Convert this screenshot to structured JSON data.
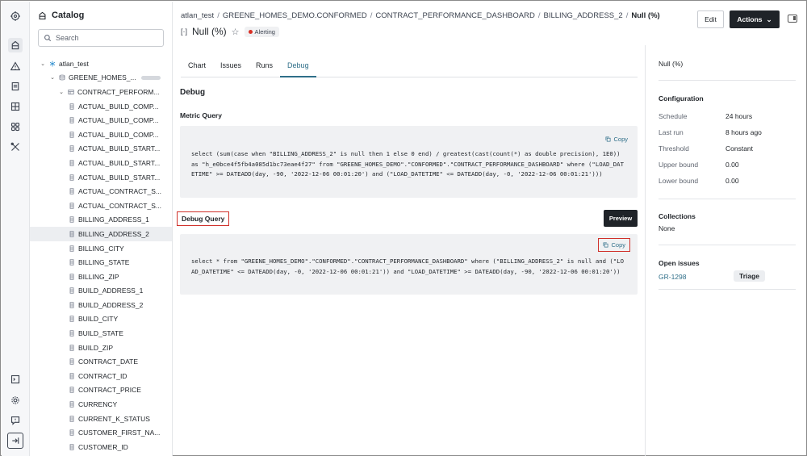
{
  "catalog": {
    "title": "Catalog",
    "search_placeholder": "Search",
    "tree": [
      {
        "label": "atlan_test",
        "level": 0,
        "chev": "⌄",
        "icon": "snowflake-icon"
      },
      {
        "label": "GREENE_HOMES_...",
        "level": 1,
        "chev": "⌄",
        "icon": "database-icon",
        "pill": true
      },
      {
        "label": "CONTRACT_PERFORM...",
        "level": 2,
        "chev": "⌄",
        "icon": "table-icon"
      },
      {
        "label": "ACTUAL_BUILD_COMP...",
        "level": 3,
        "icon": "column-icon"
      },
      {
        "label": "ACTUAL_BUILD_COMP...",
        "level": 3,
        "icon": "column-icon"
      },
      {
        "label": "ACTUAL_BUILD_COMP...",
        "level": 3,
        "icon": "column-icon"
      },
      {
        "label": "ACTUAL_BUILD_START...",
        "level": 3,
        "icon": "column-icon"
      },
      {
        "label": "ACTUAL_BUILD_START...",
        "level": 3,
        "icon": "column-icon"
      },
      {
        "label": "ACTUAL_BUILD_START...",
        "level": 3,
        "icon": "column-icon"
      },
      {
        "label": "ACTUAL_CONTRACT_S...",
        "level": 3,
        "icon": "column-icon"
      },
      {
        "label": "ACTUAL_CONTRACT_S...",
        "level": 3,
        "icon": "column-icon"
      },
      {
        "label": "BILLING_ADDRESS_1",
        "level": 3,
        "icon": "column-icon"
      },
      {
        "label": "BILLING_ADDRESS_2",
        "level": 3,
        "icon": "column-icon",
        "selected": true
      },
      {
        "label": "BILLING_CITY",
        "level": 3,
        "icon": "column-icon"
      },
      {
        "label": "BILLING_STATE",
        "level": 3,
        "icon": "column-icon"
      },
      {
        "label": "BILLING_ZIP",
        "level": 3,
        "icon": "column-icon"
      },
      {
        "label": "BUILD_ADDRESS_1",
        "level": 3,
        "icon": "column-icon"
      },
      {
        "label": "BUILD_ADDRESS_2",
        "level": 3,
        "icon": "column-icon"
      },
      {
        "label": "BUILD_CITY",
        "level": 3,
        "icon": "column-icon"
      },
      {
        "label": "BUILD_STATE",
        "level": 3,
        "icon": "column-icon"
      },
      {
        "label": "BUILD_ZIP",
        "level": 3,
        "icon": "column-icon"
      },
      {
        "label": "CONTRACT_DATE",
        "level": 3,
        "icon": "column-icon"
      },
      {
        "label": "CONTRACT_ID",
        "level": 3,
        "icon": "column-icon"
      },
      {
        "label": "CONTRACT_PRICE",
        "level": 3,
        "icon": "column-icon"
      },
      {
        "label": "CURRENCY",
        "level": 3,
        "icon": "column-icon"
      },
      {
        "label": "CURRENT_K_STATUS",
        "level": 3,
        "icon": "column-icon"
      },
      {
        "label": "CUSTOMER_FIRST_NA...",
        "level": 3,
        "icon": "column-icon"
      },
      {
        "label": "CUSTOMER_ID",
        "level": 3,
        "icon": "column-icon"
      }
    ]
  },
  "breadcrumb": {
    "items": [
      "atlan_test",
      "GREENE_HOMES_DEMO.CONFORMED",
      "CONTRACT_PERFORMANCE_DASHBOARD",
      "BILLING_ADDRESS_2"
    ],
    "current": "Null (%)",
    "separator": "/"
  },
  "header": {
    "bracket": "[·]",
    "title": "Null (%)",
    "star": "☆",
    "badge": "Alerting",
    "edit_label": "Edit",
    "actions_label": "Actions",
    "actions_chevron": "⌄"
  },
  "tabs": [
    {
      "label": "Chart",
      "active": false
    },
    {
      "label": "Issues",
      "active": false
    },
    {
      "label": "Runs",
      "active": false
    },
    {
      "label": "Debug",
      "active": true
    }
  ],
  "debug": {
    "heading": "Debug",
    "metric_heading": "Metric Query",
    "copy_label": "Copy",
    "metric_query": "select (sum(case when \"BILLING_ADDRESS_2\" is null then 1 else 0 end) / greatest(cast(count(*) as double precision), 1E0)) as \"h_e0bce4f5fb4a085d1bc73eae4f27\" from \"GREENE_HOMES_DEMO\".\"CONFORMED\".\"CONTRACT_PERFORMANCE_DASHBOARD\" where (\"LOAD_DATETIME\" >= DATEADD(day, -90, '2022-12-06 00:01:20') and (\"LOAD_DATETIME\" <= DATEADD(day, -0, '2022-12-06 00:01:21')))",
    "debug_heading": "Debug Query",
    "preview_label": "Preview",
    "debug_query": "select * from \"GREENE_HOMES_DEMO\".\"CONFORMED\".\"CONTRACT_PERFORMANCE_DASHBOARD\" where (\"BILLING_ADDRESS_2\" is null and (\"LOAD_DATETIME\" <= DATEADD(day, -0, '2022-12-06 00:01:21')) and \"LOAD_DATETIME\" >= DATEADD(day, -90, '2022-12-06 00:01:20'))"
  },
  "right_panel": {
    "title": "Null (%)",
    "configuration_heading": "Configuration",
    "config": [
      {
        "key": "Schedule",
        "value": "24 hours"
      },
      {
        "key": "Last run",
        "value": "8 hours ago"
      },
      {
        "key": "Threshold",
        "value": "Constant"
      },
      {
        "key": "Upper bound",
        "value": "0.00"
      },
      {
        "key": "Lower bound",
        "value": "0.00"
      }
    ],
    "collections_heading": "Collections",
    "collections_value": "None",
    "open_issues_heading": "Open issues",
    "issue_id": "GR-1298",
    "issue_tag": "Triage"
  },
  "colors": {
    "accent": "#2f6f89",
    "alert": "#d93025",
    "highlight": "#d0302a",
    "dark_button": "#1f2328"
  }
}
